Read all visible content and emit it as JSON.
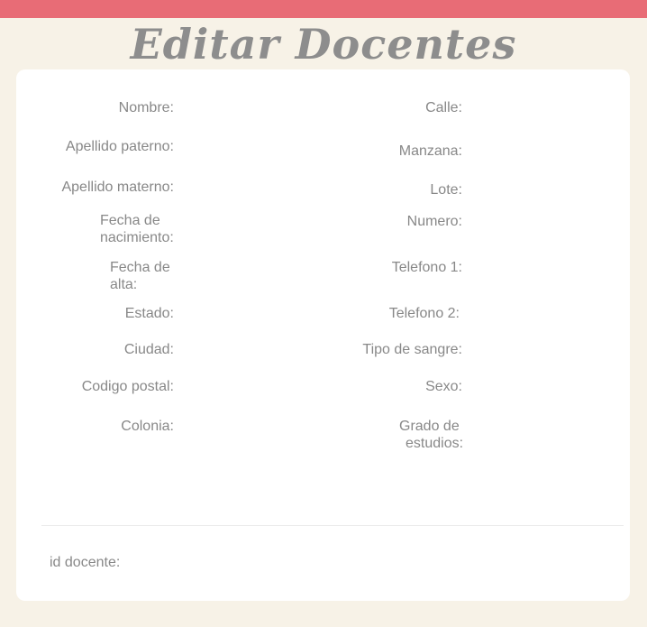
{
  "header": {
    "title": "Editar Docentes"
  },
  "form": {
    "left": {
      "nombre": "Nombre:",
      "apellido_paterno": "Apellido paterno:",
      "apellido_materno": "Apellido materno:",
      "fecha_nacimiento_l1": "Fecha de",
      "fecha_nacimiento_l2": "nacimiento:",
      "fecha_alta_l1": "Fecha de",
      "fecha_alta_l2": "alta:",
      "estado": "Estado:",
      "ciudad": "Ciudad:",
      "codigo_postal": "Codigo postal:",
      "colonia": "Colonia:"
    },
    "right": {
      "calle": "Calle:",
      "manzana": "Manzana:",
      "lote": "Lote:",
      "numero": "Numero:",
      "telefono1": "Telefono 1:",
      "telefono2": "Telefono 2:",
      "tipo_sangre": "Tipo de sangre:",
      "sexo": "Sexo:",
      "grado_estudios_l1": "Grado de",
      "grado_estudios_l2": "estudios:"
    },
    "footer": {
      "id_docente": "id docente:"
    }
  }
}
